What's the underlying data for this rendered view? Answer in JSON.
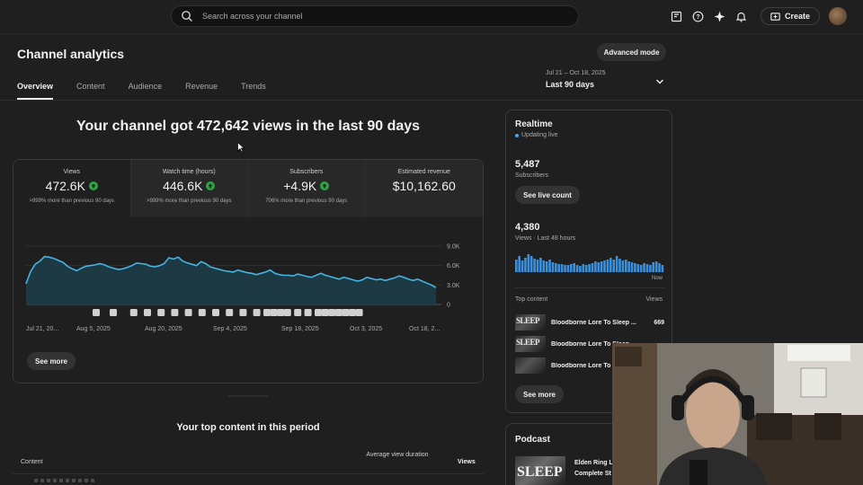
{
  "topbar": {
    "search_placeholder": "Search across your channel",
    "create_label": "Create",
    "icons": [
      "search-icon",
      "feedback-icon",
      "help-icon",
      "sparkle-icon",
      "bell-icon",
      "create-plus-icon"
    ]
  },
  "header": {
    "title": "Channel analytics",
    "advanced_mode_label": "Advanced mode",
    "tabs": [
      {
        "label": "Overview",
        "active": true
      },
      {
        "label": "Content",
        "active": false
      },
      {
        "label": "Audience",
        "active": false
      },
      {
        "label": "Revenue",
        "active": false
      },
      {
        "label": "Trends",
        "active": false
      }
    ],
    "date_range": {
      "dates": "Jul 21 – Oct 18, 2025",
      "label": "Last 90 days"
    }
  },
  "headline": "Your channel got 472,642 views in the last 90 days",
  "metrics": [
    {
      "label": "Views",
      "value": "472.6K",
      "note": ">999% more than previous 90 days",
      "up": true
    },
    {
      "label": "Watch time (hours)",
      "value": "446.6K",
      "note": ">999% more than previous 90 days",
      "up": true
    },
    {
      "label": "Subscribers",
      "value": "+4.9K",
      "note": "706% more than previous 90 days",
      "up": true
    },
    {
      "label": "Estimated revenue",
      "value": "$10,162.60",
      "note": "",
      "up": false
    }
  ],
  "chart_data": {
    "type": "area",
    "title": "",
    "xlabel": "",
    "ylabel": "",
    "ylim": [
      0,
      9000
    ],
    "y_ticks": [
      "9.0K",
      "6.0K",
      "3.0K",
      "0"
    ],
    "x_tick_labels": [
      "Jul 21, 20...",
      "Aug 5, 2025",
      "Aug 20, 2025",
      "Sep 4, 2025",
      "Sep 18, 2025",
      "Oct 3, 2025",
      "Oct 18, 2..."
    ],
    "series": [
      {
        "values": [
          3200,
          5100,
          6200,
          6700,
          7400,
          7300,
          7100,
          6800,
          6500,
          5900,
          5500,
          5200,
          5600,
          5900,
          6000,
          6100,
          6300,
          6100,
          5800,
          5600,
          5400,
          5500,
          5700,
          6000,
          6400,
          6300,
          6200,
          5900,
          5800,
          6000,
          6300,
          7200,
          7000,
          7300,
          6700,
          6400,
          6200,
          6000,
          6600,
          6300,
          5800,
          5600,
          5400,
          5200,
          5100,
          5000,
          5300,
          5100,
          4900,
          4800,
          4600,
          4800,
          5000,
          5300,
          4800,
          4600,
          4500,
          4500,
          4400,
          4700,
          4500,
          4300,
          4200,
          4500,
          4800,
          4500,
          4300,
          4100,
          3900,
          4200,
          4000,
          3800,
          3600,
          3800,
          4200,
          4000,
          3800,
          3900,
          3700,
          3900,
          4100,
          4400,
          4200,
          3900,
          3700,
          3900,
          3600,
          3300,
          3000,
          2600
        ]
      }
    ],
    "markers": [
      4,
      5,
      6,
      4,
      4,
      4,
      4,
      4,
      4,
      4,
      4,
      4,
      3,
      2,
      2,
      2,
      3,
      3,
      3,
      2,
      2,
      2,
      2,
      2,
      2
    ]
  },
  "see_more_label": "See more",
  "top_content": {
    "title": "Your top content in this period",
    "col_content": "Content",
    "col_avg": "Average view duration",
    "col_views": "Views"
  },
  "realtime": {
    "title": "Realtime",
    "live": "Updating live",
    "subscribers_value": "5,487",
    "subscribers_label": "Subscribers",
    "live_count_label": "See live count",
    "views_value": "4,380",
    "views_label": "Views · Last 48 hours",
    "now_label": "Now",
    "bars": [
      14,
      18,
      13,
      16,
      20,
      18,
      15,
      14,
      16,
      13,
      12,
      14,
      11,
      10,
      9,
      9,
      8,
      8,
      9,
      10,
      8,
      7,
      9,
      8,
      9,
      10,
      12,
      11,
      12,
      13,
      14,
      16,
      14,
      18,
      15,
      13,
      14,
      12,
      11,
      10,
      9,
      8,
      10,
      9,
      8,
      11,
      12,
      10,
      8
    ],
    "top_content_label": "Top content",
    "views_col_label": "Views",
    "items": [
      {
        "thumb": "SLEEP",
        "title": "Bloodborne Lore To Sleep ...",
        "views": "669"
      },
      {
        "thumb": "SLEEP",
        "title": "Bloodborne Lore To Sleep ...",
        "views": "..."
      },
      {
        "thumb": "",
        "title": "Bloodborne Lore To Sleep ...",
        "views": ""
      }
    ]
  },
  "podcast": {
    "title": "Podcast",
    "thumb": "SLEEP",
    "item_line1": "Elden Ring L",
    "item_line2": "Complete St"
  }
}
